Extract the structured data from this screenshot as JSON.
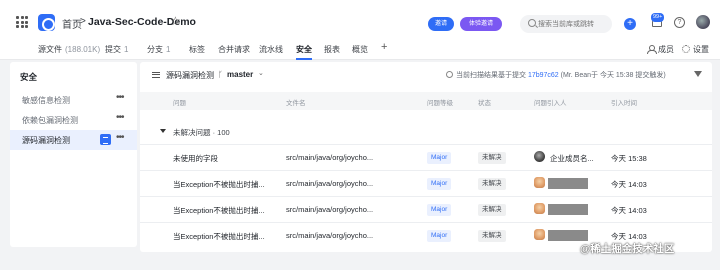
{
  "header": {
    "breadcrumb_home": "首页",
    "breadcrumb_sep": ">",
    "repo_name": "Java-Sec-Code-Demo",
    "invite_label": "邀请",
    "experience_label": "体验邀请",
    "search_placeholder": "搜索当前库或跳转",
    "notification_count": "99+"
  },
  "tabs": [
    {
      "label": "源文件",
      "count": "(188.01K)"
    },
    {
      "label": "提交",
      "count": "1"
    },
    {
      "label": "分支",
      "count": "1"
    },
    {
      "label": "标签",
      "count": ""
    },
    {
      "label": "合并请求",
      "count": ""
    },
    {
      "label": "流水线",
      "count": ""
    },
    {
      "label": "安全",
      "count": ""
    },
    {
      "label": "报表",
      "count": ""
    },
    {
      "label": "概览",
      "count": ""
    }
  ],
  "tab_right": {
    "members": "成员",
    "settings": "设置"
  },
  "sidebar": {
    "title": "安全",
    "items": [
      {
        "label": "敏感信息检测",
        "more": "•••"
      },
      {
        "label": "依赖包漏洞检测",
        "more": "•••"
      },
      {
        "label": "源码漏洞检测",
        "more": "•••"
      }
    ]
  },
  "toolbar": {
    "title": "源码漏洞检测",
    "branch": "master",
    "scan_prefix": "当前扫描结果基于提交",
    "commit": "17b97c62",
    "scan_suffix": "(Mr. Bean于 今天 15:38 提交触发)"
  },
  "table": {
    "columns": [
      "问题",
      "文件名",
      "问题等级",
      "状态",
      "问题引入人",
      "引入时间"
    ],
    "group_label": "未解决问题 · 100",
    "rows": [
      {
        "issue": "未使用的字段",
        "file": "src/main/java/org/joycho...",
        "level": "Major",
        "status": "未解决",
        "user": "企业成员名...",
        "time": "今天 15:38"
      },
      {
        "issue": "当Exception不被抛出时捕...",
        "file": "src/main/java/org/joycho...",
        "level": "Major",
        "status": "未解决",
        "user": "",
        "time": "今天 14:03"
      },
      {
        "issue": "当Exception不被抛出时捕...",
        "file": "src/main/java/org/joycho...",
        "level": "Major",
        "status": "未解决",
        "user": "",
        "time": "今天 14:03"
      },
      {
        "issue": "当Exception不被抛出时捕...",
        "file": "src/main/java/org/joycho...",
        "level": "Major",
        "status": "未解决",
        "user": "",
        "time": "今天 14:03"
      }
    ]
  },
  "watermark": "@稀土掘金技术社区"
}
